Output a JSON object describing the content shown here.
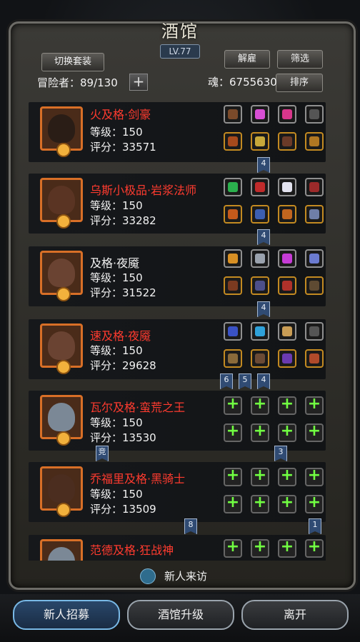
{
  "header": {
    "title": "酒馆",
    "level": "LV.77",
    "switch_outfit": "切换套装",
    "dismiss": "解雇",
    "filter": "筛选",
    "sort": "排序",
    "adventurers_label": "冒险者：89/130",
    "plus": "+",
    "soul_label": "魂：6755630"
  },
  "heroes": [
    {
      "name": "火及格·剑豪",
      "name_color": "red",
      "level": "等级：150",
      "score": "评分：33571"
    },
    {
      "name": "乌斯小极品·岩浆法师",
      "name_color": "red",
      "level": "等级：150",
      "score": "评分：33282"
    },
    {
      "name": "及格·夜魇",
      "name_color": "white",
      "level": "等级：150",
      "score": "评分：31522"
    },
    {
      "name": "速及格·夜魇",
      "name_color": "red",
      "level": "等级：150",
      "score": "评分：29628"
    },
    {
      "name": "瓦尔及格·蛮荒之王",
      "name_color": "red",
      "level": "等级：150",
      "score": "评分：13530"
    },
    {
      "name": "乔福里及格·黑骑士",
      "name_color": "red",
      "level": "等级：150",
      "score": "评分：13509"
    },
    {
      "name": "范德及格·狂战神",
      "name_color": "red",
      "level": "",
      "score": ""
    }
  ],
  "tags": [
    "4",
    "4",
    "4",
    "6",
    "5",
    "4",
    "竞",
    "3",
    "8",
    "1"
  ],
  "visitor": "新人来访",
  "bottom": {
    "recruit": "新人招募",
    "upgrade": "酒馆升级",
    "leave": "离开"
  },
  "colors": {
    "accent_red": "#ff3b2f",
    "plus_green": "#71ff42",
    "tag_blue": "#304b73"
  }
}
